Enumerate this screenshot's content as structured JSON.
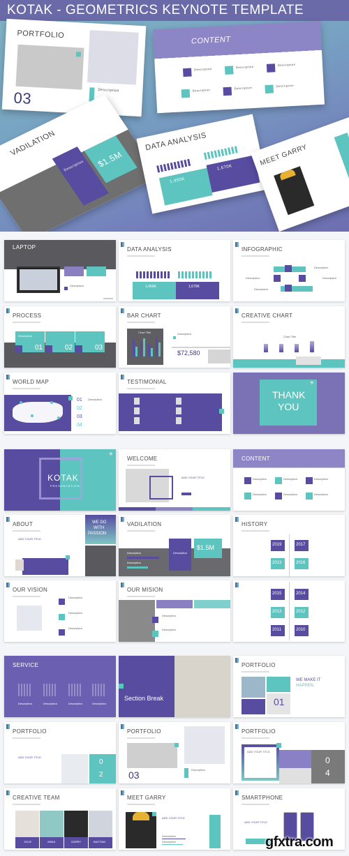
{
  "header": {
    "title": "KOTAK - GEOMETRICS KEYNOTE TEMPLATE"
  },
  "colors": {
    "purple": "#574ca0",
    "teal": "#5ec4c0",
    "title_bar": "#6a6aa8"
  },
  "hero": {
    "portfolio": {
      "title": "PORTFOLIO",
      "number": "03",
      "desc": "Description"
    },
    "content": {
      "title": "CONTENT",
      "items": [
        "Description",
        "Description",
        "Description",
        "Description",
        "Description",
        "Description"
      ]
    },
    "vadilation": {
      "title": "VADILATION",
      "value": "$1.5M",
      "desc": "Description"
    },
    "data_analysis": {
      "title": "DATA ANALYSIS",
      "value1": "1,450K",
      "value2": "1,670K"
    },
    "meet_garry": {
      "title": "MEET GARRY"
    }
  },
  "slides": [
    {
      "title": "LAPTOP",
      "desc": "Description"
    },
    {
      "title": "DATA ANALYSIS",
      "value1": "1,450K",
      "value2": "1,670K"
    },
    {
      "title": "INFOGRAPHIC",
      "items": [
        "Description",
        "Description",
        "Description",
        "Description"
      ]
    },
    {
      "title": "PROCESS",
      "steps": [
        "01",
        "02",
        "03"
      ],
      "step_label": "Description"
    },
    {
      "title": "BAR CHART",
      "chart_title": "Chart Title",
      "value": "$72,580",
      "desc": "Description"
    },
    {
      "title": "CREATIVE CHART",
      "chart_title": "Chart Title"
    },
    {
      "title": "WORLD MAP",
      "items": [
        "01",
        "02",
        "03",
        "04"
      ],
      "item_label": "Description"
    },
    {
      "title": "TESTIMONIAL"
    },
    {
      "title": "THANK YOU",
      "line1": "THANK",
      "line2": "YOU"
    },
    {
      "title": "KOTAK",
      "subtitle": "PRESENTATION"
    },
    {
      "title": "WELCOME",
      "subtitle": "ADD YOUR TITLE"
    },
    {
      "title": "CONTENT",
      "items": [
        "Description",
        "Description",
        "Description",
        "Description",
        "Description",
        "Description"
      ]
    },
    {
      "title": "ABOUT",
      "side": [
        "WE DO",
        "WITH",
        "PASSION"
      ],
      "subtitle": "ADD YOUR TITLE"
    },
    {
      "title": "VADILATION",
      "value": "$1.5M",
      "items": [
        "Description",
        "Description"
      ],
      "desc": "Description"
    },
    {
      "title": "HISTORY",
      "years": [
        "2019",
        "2017",
        "2013",
        "2016"
      ]
    },
    {
      "title": "OUR VISION",
      "items": [
        "Description",
        "Description",
        "Description"
      ]
    },
    {
      "title": "OUR MISION",
      "items": [
        "Description",
        "Description"
      ]
    },
    {
      "title": "",
      "years": [
        "2015",
        "2014",
        "2013",
        "2012",
        "2011",
        "2010"
      ]
    },
    {
      "title": "SERVICE",
      "items": [
        "Description",
        "Description",
        "Description",
        "Description"
      ]
    },
    {
      "title": "Section Break"
    },
    {
      "title": "PORTFOLIO",
      "headline1": "WE MAKE IT",
      "headline2": "HAPPEN.",
      "number": "01"
    },
    {
      "title": "PORTFOLIO",
      "number_top": "0",
      "number_bottom": "2",
      "subtitle": "ADD YOUR TITLE"
    },
    {
      "title": "PORTFOLIO",
      "number": "03",
      "desc": "Description"
    },
    {
      "title": "PORTFOLIO",
      "number_top": "0",
      "number_bottom": "4",
      "subtitle": "ADD YOUR TITLE"
    },
    {
      "title": "CREATIVE TEAM",
      "members": [
        "JOLIE",
        "ANNA",
        "GARRY",
        "BASTIAN"
      ]
    },
    {
      "title": "MEET GARRY",
      "items": [
        "Description",
        "Description"
      ],
      "subtitle": "ADD YOUR TITLE"
    },
    {
      "title": "SMARTPHONE",
      "subtitle": "ADD YOUR TITLE"
    }
  ],
  "watermark": "gfxtra.com"
}
